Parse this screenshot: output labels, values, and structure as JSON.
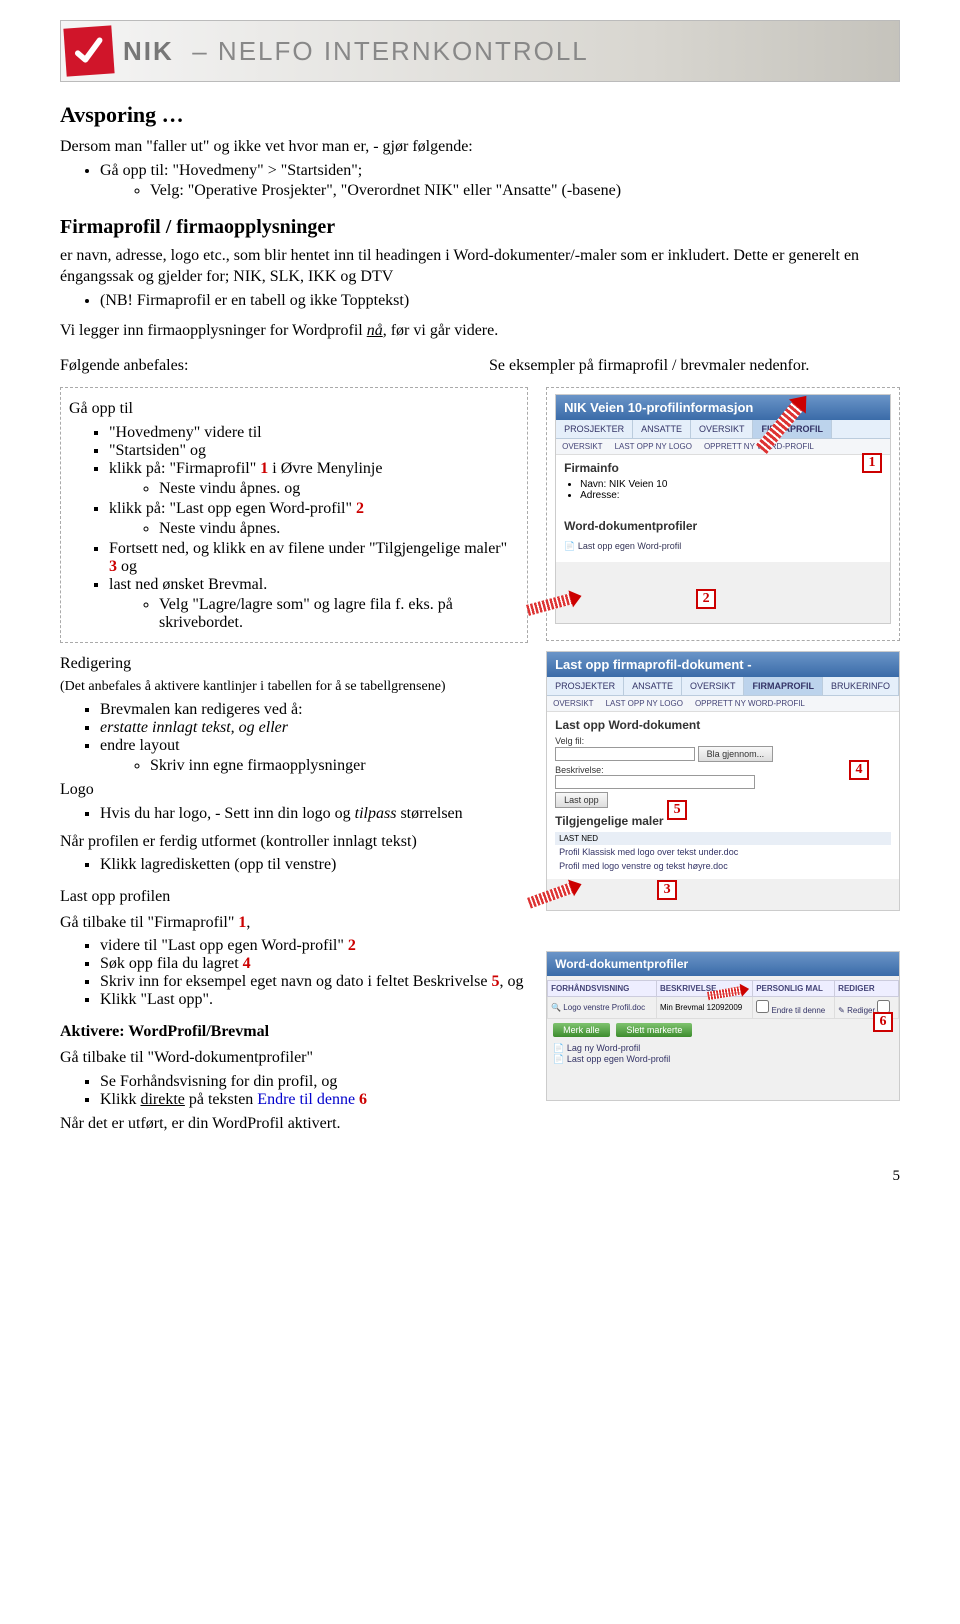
{
  "banner": {
    "brand": "NIK",
    "subtitle": "NELFO INTERNKONTROLL"
  },
  "s1": {
    "title": "Avsporing …",
    "intro": "Dersom man \"faller ut\" og ikke vet hvor man er, - gjør følgende:",
    "b1": "Gå opp til: \"Hovedmeny\" > \"Startsiden\";",
    "b1a": "Velg: \"Operative Prosjekter\", \"Overordnet NIK\" eller \"Ansatte\" (-basene)"
  },
  "s2": {
    "title": "Firmaprofil / firmaopplysninger",
    "p1": "er navn, adresse, logo etc., som blir hentet inn til headingen i Word-dokumenter/-maler som er inkludert. Dette er generelt en éngangssak og gjelder for; NIK, SLK, IKK og DTV",
    "note": "(NB! Firmaprofil er en tabell og ikke Topptekst)",
    "p2a": "Vi legger inn firmaopplysninger for Wordprofil ",
    "p2b": "nå",
    "p2c": ", før vi går videre.",
    "left_label": "Følgende anbefales:",
    "right_label": "Se eksempler på firmaprofil / brevmaler nedenfor."
  },
  "steps1": {
    "head": "Gå opp til",
    "i1": "\"Hovedmeny\" videre til",
    "i2": "\"Startsiden\" og",
    "i3a": "klikk på: \"Firmaprofil\" ",
    "i3b": "1",
    "i3c": " i Øvre Menylinje",
    "i3o": "Neste vindu åpnes. og",
    "i4a": "klikk på: \"Last opp egen Word-profil\" ",
    "i4b": "2",
    "i4o": "Neste vindu åpnes.",
    "i5": "Fortsett ned, og klikk en av filene under \"Tilgjengelige maler\" ",
    "i5b": "3",
    "i5c": " og",
    "i6": "last ned ønsket Brevmal.",
    "i6o": "Velg \"Lagre/lagre som\" og lagre fila f. eks. på skrivebordet."
  },
  "edit": {
    "h": "Redigering",
    "sub": "(Det anbefales å aktivere kantlinjer i tabellen for å se tabellgrensene)",
    "b1": "Brevmalen  kan redigeres ved å:",
    "b2": "erstatte innlagt tekst, og eller",
    "b3": "endre layout",
    "b3o": "Skriv inn egne firmaopplysninger",
    "logo_h": "Logo",
    "logo1a": "Hvis du har logo, - Sett inn din logo og ",
    "logo1b": "tilpass",
    "logo1c": " størrelsen",
    "done": "Når profilen er ferdig utformet (kontroller innlagt tekst)",
    "done1": "Klikk lagredisketten (opp til venstre)"
  },
  "upload": {
    "h": "Last opp profilen",
    "p1a": "Gå tilbake til \"Firmaprofil\" ",
    "p1b": "1",
    "p1c": ",",
    "b1a": "videre til \"Last opp egen Word-profil\" ",
    "b1b": "2",
    "b2a": "Søk opp fila du lagret  ",
    "b2b": "4",
    "b3a": "Skriv inn for eksempel eget navn og dato i feltet Beskrivelse  ",
    "b3b": "5",
    "b3c": ", og",
    "b4": "Klikk \"Last opp\"."
  },
  "activate": {
    "h": "Aktivere: WordProfil/Brevmal",
    "p1": "Gå tilbake til \"Word-dokumentprofiler\"",
    "b1": "Se Forhåndsvisning for din profil, og",
    "b2a": "Klikk ",
    "b2b": "direkte",
    "b2c": " på teksten ",
    "b2d": "Endre til denne",
    "b2e": " 6",
    "p2": "Når det er utført, er din WordProfil aktivert."
  },
  "shot1": {
    "title": "NIK Veien 10-profilinformasjon",
    "tabs": [
      "PROSJEKTER",
      "ANSATTE",
      "OVERSIKT",
      "FIRMAPROFIL"
    ],
    "sub": [
      "OVERSIKT",
      "LAST OPP NY LOGO",
      "OPPRETT NY WORD-PROFIL"
    ],
    "panel_h": "Firmainfo",
    "line1": "Navn: NIK Veien 10",
    "line2": "Adresse:",
    "wh": "Word-dokumentprofiler",
    "link": "Last opp egen Word-profil"
  },
  "shot2": {
    "title": "Last opp firmaprofil-dokument -",
    "tabs": [
      "PROSJEKTER",
      "ANSATTE",
      "OVERSIKT",
      "FIRMAPROFIL",
      "BRUKERINFO"
    ],
    "sub": [
      "OVERSIKT",
      "LAST OPP NY LOGO",
      "OPPRETT NY WORD-PROFIL"
    ],
    "panel_h": "Last opp Word-dokument",
    "f1": "Velg fil:",
    "browse": "Bla gjennom...",
    "f2": "Beskrivelse:",
    "btn": "Last opp",
    "tilg": "Tilgjengelige maler",
    "last_ned": "LAST NED",
    "m1": "Profil Klassisk med logo over tekst under.doc",
    "m2": "Profil med logo venstre og tekst høyre.doc"
  },
  "shot3": {
    "wh": "Word-dokumentprofiler",
    "cols": [
      "FORHÅNDSVISNING",
      "BESKRIVELSE",
      "PERSONLIG MAL",
      "REDIGER"
    ],
    "row_a": "Logo venstre Profil.doc",
    "row_b": "Min Brevmal 12092009",
    "row_c": "Endre til denne",
    "row_d": "Rediger",
    "g1": "Merk alle",
    "g2": "Slett markerte",
    "l1": "Lag ny Word-profil",
    "l2": "Last opp egen Word-profil"
  },
  "callouts": {
    "c1": "1",
    "c2": "2",
    "c3": "3",
    "c4": "4",
    "c5": "5",
    "c6": "6"
  },
  "page": "5"
}
